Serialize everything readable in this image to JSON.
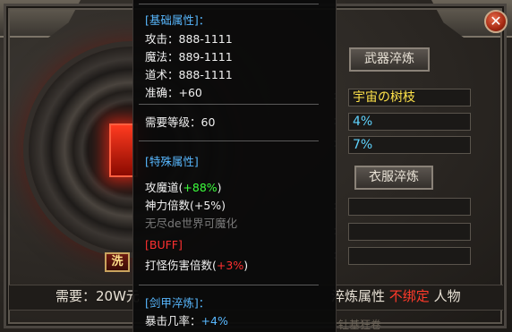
{
  "window": {
    "close_icon": "close-icon"
  },
  "left": {
    "refine_button_label": "洗"
  },
  "right": {
    "weapon_refine_label": "武器淬炼",
    "armor_refine_label": "衣服淬炼",
    "fields": [
      {
        "value": "宇宙の树枝"
      },
      {
        "value": "4%"
      },
      {
        "value": "7%"
      },
      {
        "value": ""
      },
      {
        "value": ""
      },
      {
        "value": ""
      }
    ]
  },
  "bottom": {
    "cost_label": "需要：20W元",
    "refine_attr": "淬炼属性",
    "not_bound": "不绑定",
    "person": "人物",
    "footer": "钍基狂卷"
  },
  "tooltip": {
    "base_title": "[基础属性]：",
    "attack": "攻击：888-1111",
    "magic": "魔法：889-1111",
    "tao": "道术：888-1111",
    "accuracy": "准确：+60",
    "level_req": "需要等级：60",
    "special_title": "[特殊属性]",
    "atk_magic_tao_prefix": "攻魔道(",
    "atk_magic_tao_val": "+88%",
    "atk_magic_tao_suffix": ")",
    "divine_mult": "神力倍数(+5%)",
    "endless_world": "无尽de世界可魔化",
    "buff_title": "[BUFF]",
    "damage_prefix": "打怪伤害倍数(",
    "damage_val": "+3%",
    "damage_suffix": ")",
    "sword_title": "[剑甲淬炼]：",
    "crit_prefix": "暴击几率：",
    "crit_val": "+4%"
  }
}
